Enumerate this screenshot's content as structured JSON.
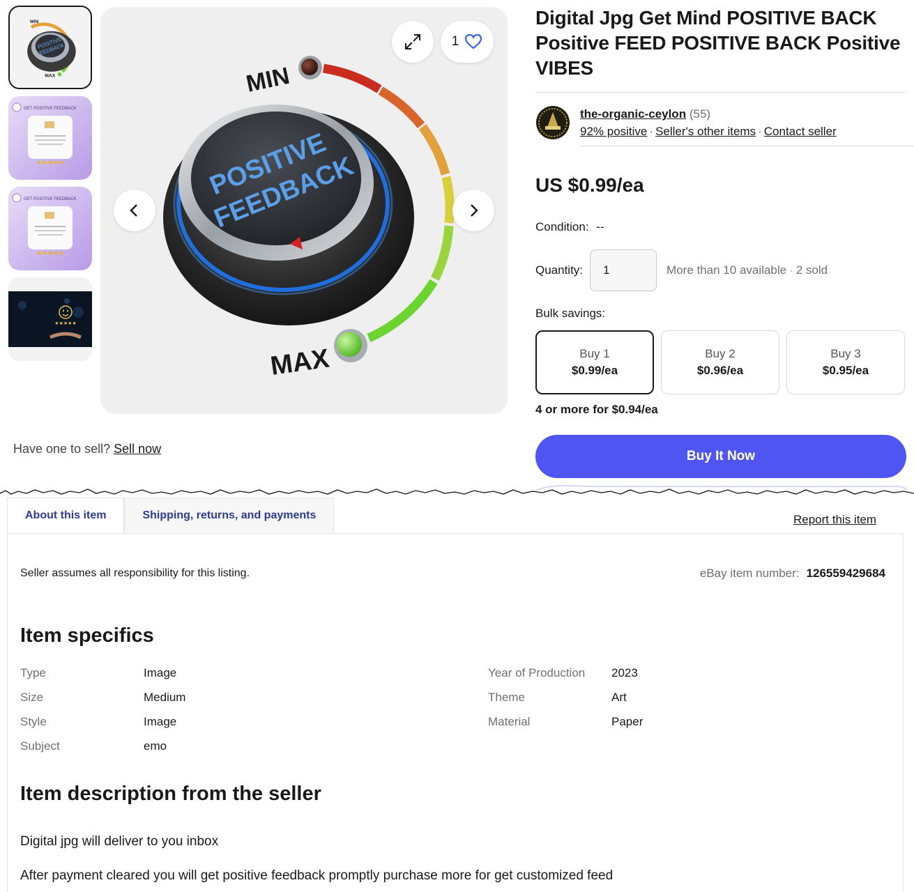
{
  "gallery": {
    "thumbnails": [
      {
        "name": "positive-feedback-knob",
        "caption": ""
      },
      {
        "name": "get-positive-feedback-card",
        "caption": "GET POSITIVE FEEDBACK"
      },
      {
        "name": "get-positive-feedback-card-2",
        "caption": "GET POSITIVE FEEDBACK"
      },
      {
        "name": "smiley-stars-hand",
        "caption": ""
      }
    ],
    "main_image": {
      "label_min": "MIN",
      "label_max": "MAX",
      "knob_line1": "POSITIVE",
      "knob_line2": "FEEDBACK"
    },
    "watch_count": "1",
    "icons": {
      "expand": "expand-icon",
      "watch": "heart-icon",
      "prev": "chevron-left-icon",
      "next": "chevron-right-icon"
    }
  },
  "sell": {
    "prompt": "Have one to sell?",
    "link": "Sell now"
  },
  "listing": {
    "title": "Digital Jpg Get Mind POSITIVE BACK Positive FEED POSITIVE BACK Positive VIBES",
    "seller": {
      "name": "the-organic-ceylon",
      "feedback_count": "(55)",
      "positive": "92% positive",
      "other_items": "Seller's other items",
      "contact": "Contact seller"
    },
    "price": "US $0.99/ea",
    "condition_label": "Condition:",
    "condition_value": "--",
    "quantity_label": "Quantity:",
    "quantity_value": "1",
    "available": "More than 10 available",
    "sold": "2 sold",
    "bulk_label": "Bulk savings:",
    "bulk_options": [
      {
        "label": "Buy 1",
        "price": "$0.99/ea",
        "selected": true
      },
      {
        "label": "Buy 2",
        "price": "$0.96/ea",
        "selected": false
      },
      {
        "label": "Buy 3",
        "price": "$0.95/ea",
        "selected": false
      }
    ],
    "bulk_more": "4 or more for $0.94/ea",
    "buy_now": "Buy It Now",
    "colors": {
      "buy_button": "#4f55f2",
      "tab_text": "#2a3c98"
    }
  },
  "details": {
    "tabs": [
      {
        "label": "About this item",
        "active": true
      },
      {
        "label": "Shipping, returns, and payments",
        "active": false
      }
    ],
    "report": "Report this item",
    "responsibility": "Seller assumes all responsibility for this listing.",
    "item_number_label": "eBay item number:",
    "item_number": "126559429684",
    "specifics_heading": "Item specifics",
    "specifics_left": [
      {
        "label": "Type",
        "value": "Image"
      },
      {
        "label": "Size",
        "value": "Medium"
      },
      {
        "label": "Style",
        "value": "Image"
      },
      {
        "label": "Subject",
        "value": "emo"
      }
    ],
    "specifics_right": [
      {
        "label": "Year of Production",
        "value": "2023"
      },
      {
        "label": "Theme",
        "value": "Art"
      },
      {
        "label": "Material",
        "value": "Paper"
      }
    ],
    "description_heading": "Item description from the seller",
    "description_lines": [
      "Digital jpg will deliver to you inbox",
      "After payment cleared you will get positive feedback promptly purchase more for get customized feed"
    ]
  }
}
